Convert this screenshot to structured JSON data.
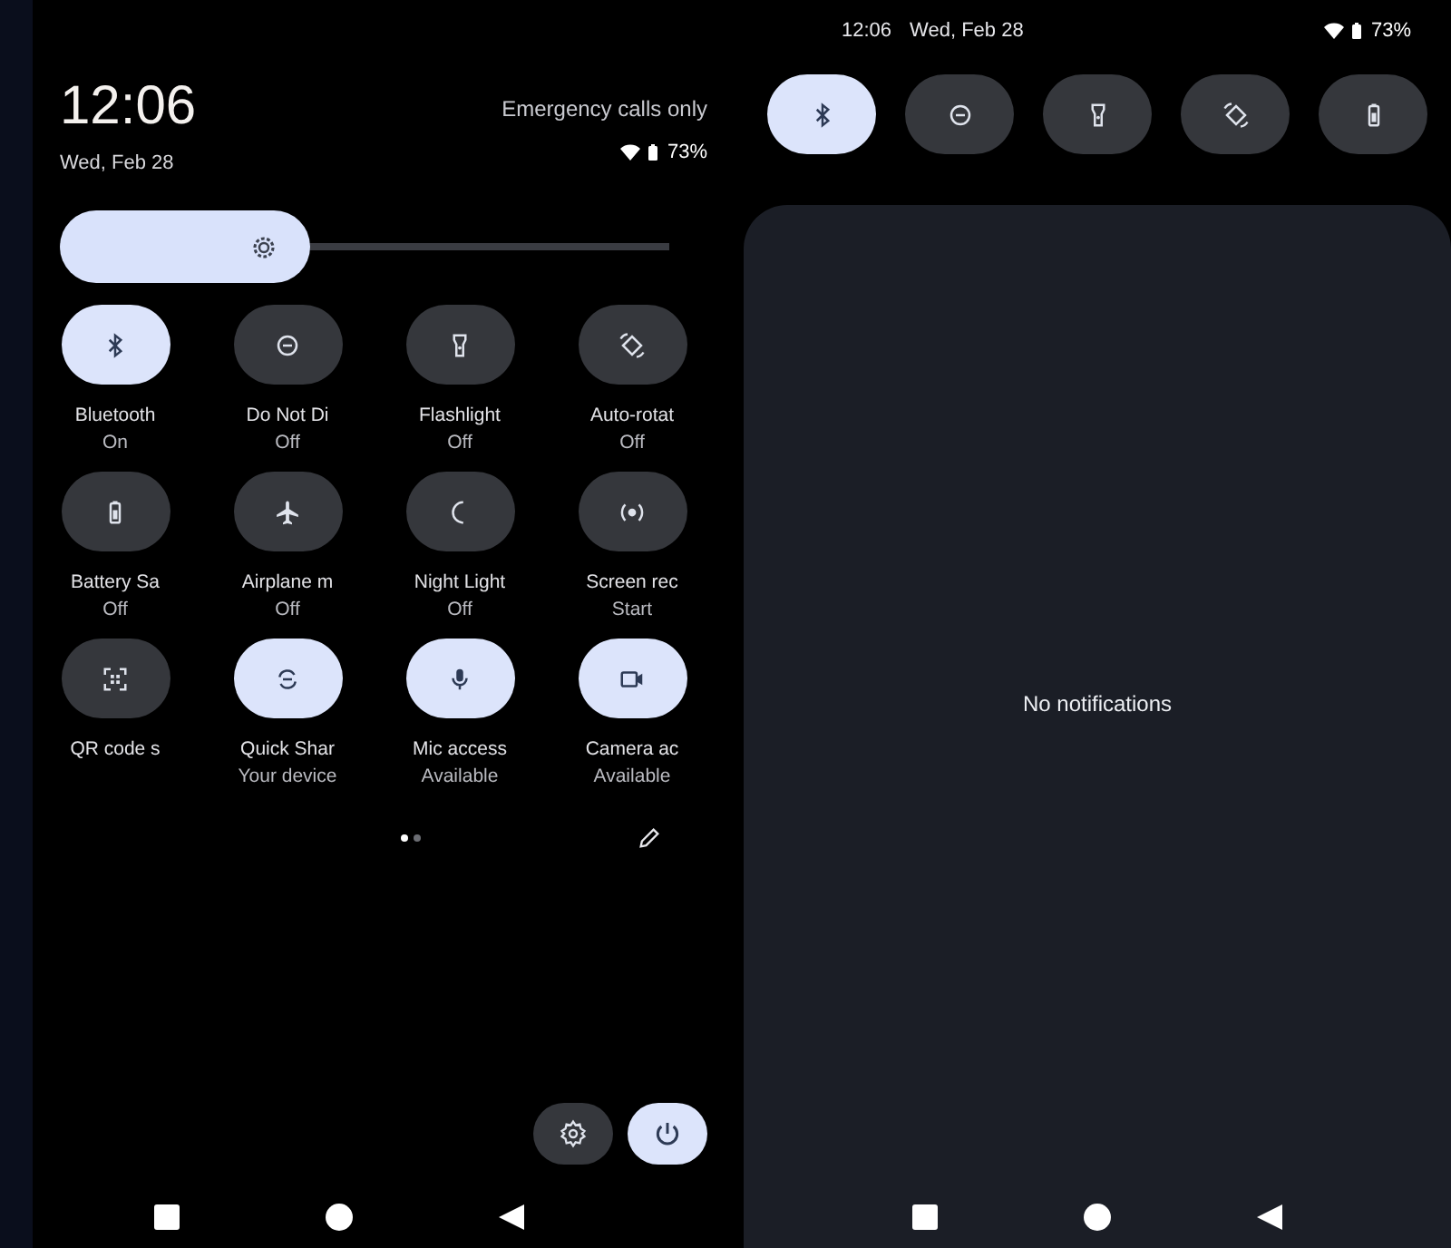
{
  "header": {
    "clock": "12:06",
    "date": "Wed, Feb 28",
    "carrier": "Emergency calls only",
    "battery": "73%"
  },
  "brightness": {
    "level": 0.41
  },
  "tiles": [
    {
      "kind": "bluetooth",
      "label": "Bluetooth",
      "status": "On",
      "on": true
    },
    {
      "kind": "dnd",
      "label": "Do Not Di",
      "status": "Off",
      "on": false
    },
    {
      "kind": "flashlight",
      "label": "Flashlight",
      "status": "Off",
      "on": false
    },
    {
      "kind": "rotate",
      "label": "Auto-rotat",
      "status": "Off",
      "on": false
    },
    {
      "kind": "battery",
      "label": "Battery Sa",
      "status": "Off",
      "on": false
    },
    {
      "kind": "airplane",
      "label": "Airplane m",
      "status": "Off",
      "on": false
    },
    {
      "kind": "moon",
      "label": "Night Light",
      "status": "Off",
      "on": false
    },
    {
      "kind": "record",
      "label": "Screen rec",
      "status": "Start",
      "on": false
    },
    {
      "kind": "qr",
      "label": "QR code s",
      "on": false
    },
    {
      "kind": "share",
      "label": "Quick Shar",
      "status": "Your device",
      "on": true
    },
    {
      "kind": "mic",
      "label": "Mic access",
      "status": "Available",
      "on": true
    },
    {
      "kind": "camera",
      "label": "Camera ac",
      "status": "Available",
      "on": true
    }
  ],
  "pages": [
    {
      "selected": true
    },
    {
      "selected": false
    }
  ],
  "right_status": {
    "time": "12:06",
    "date": "Wed, Feb 28",
    "battery": "73%"
  },
  "quick_tiles": [
    {
      "kind": "bluetooth",
      "on": true
    },
    {
      "kind": "dnd",
      "on": false
    },
    {
      "kind": "flashlight",
      "on": false
    },
    {
      "kind": "rotate",
      "on": false
    },
    {
      "kind": "battery",
      "on": false
    }
  ],
  "notifications": {
    "empty_text": "No notifications"
  }
}
